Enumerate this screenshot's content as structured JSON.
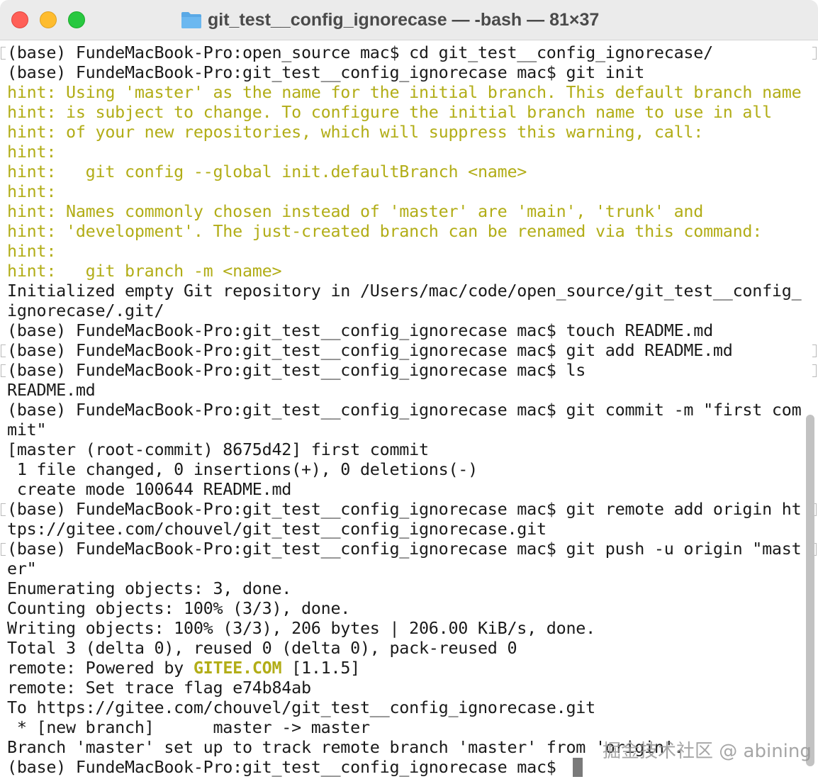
{
  "window": {
    "title": "git_test__config_ignorecase — -bash — 81×37"
  },
  "watermark": "掘金技术社区 @ abining",
  "terminal": {
    "lines": [
      "(base) FundeMacBook-Pro:open_source mac$ cd git_test__config_ignorecase/",
      "(base) FundeMacBook-Pro:git_test__config_ignorecase mac$ git init",
      "hint: Using 'master' as the name for the initial branch. This default branch name",
      "hint: is subject to change. To configure the initial branch name to use in all",
      "hint: of your new repositories, which will suppress this warning, call:",
      "hint:",
      "hint:   git config --global init.defaultBranch <name>",
      "hint:",
      "hint: Names commonly chosen instead of 'master' are 'main', 'trunk' and",
      "hint: 'development'. The just-created branch can be renamed via this command:",
      "hint:",
      "hint:   git branch -m <name>",
      "Initialized empty Git repository in /Users/mac/code/open_source/git_test__config_",
      "ignorecase/.git/",
      "(base) FundeMacBook-Pro:git_test__config_ignorecase mac$ touch README.md",
      "(base) FundeMacBook-Pro:git_test__config_ignorecase mac$ git add README.md",
      "(base) FundeMacBook-Pro:git_test__config_ignorecase mac$ ls",
      "README.md",
      "(base) FundeMacBook-Pro:git_test__config_ignorecase mac$ git commit -m \"first com",
      "mit\"",
      "[master (root-commit) 8675d42] first commit",
      " 1 file changed, 0 insertions(+), 0 deletions(-)",
      " create mode 100644 README.md",
      "(base) FundeMacBook-Pro:git_test__config_ignorecase mac$ git remote add origin ht",
      "tps://gitee.com/chouvel/git_test__config_ignorecase.git",
      "(base) FundeMacBook-Pro:git_test__config_ignorecase mac$ git push -u origin \"mast",
      "er\"",
      "Enumerating objects: 3, done.",
      "Counting objects: 100% (3/3), done.",
      "Writing objects: 100% (3/3), 206 bytes | 206.00 KiB/s, done.",
      "Total 3 (delta 0), reused 0 (delta 0), pack-reused 0",
      "remote: Powered by ",
      "remote: Set trace flag e74b84ab",
      "To https://gitee.com/chouvel/git_test__config_ignorecase.git",
      " * [new branch]      master -> master",
      "Branch 'master' set up to track remote branch 'master' from 'origin'.",
      "(base) FundeMacBook-Pro:git_test__config_ignorecase mac$ "
    ],
    "powered_by_brand": "GITEE.COM",
    "powered_by_version": " [1.1.5]"
  },
  "colors": {
    "hint_text": "#b2ad17",
    "text": "#1a1a1a",
    "close": "#ff5f57",
    "minimize": "#febc2e",
    "zoom": "#28c840",
    "folder": "#5aa9e6"
  }
}
